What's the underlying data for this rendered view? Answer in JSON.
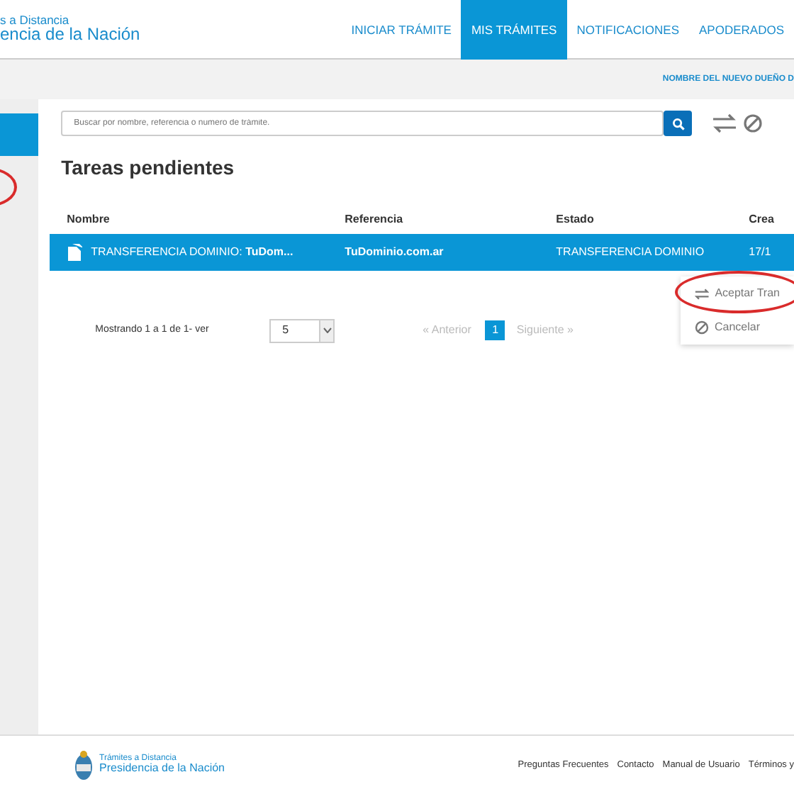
{
  "header": {
    "logo_line1": "s a Distancia",
    "logo_line2": "encia de la Nación",
    "nav": [
      {
        "label": "INICIAR TRÁMITE",
        "selected": false
      },
      {
        "label": "MIS TRÁMITES",
        "selected": true
      },
      {
        "label": "NOTIFICACIONES",
        "selected": false
      },
      {
        "label": "APODERADOS",
        "selected": false
      }
    ]
  },
  "subbar": {
    "user": "NOMBRE DEL NUEVO DUEÑO D"
  },
  "sidebar": {
    "items": [
      {
        "selected": true
      }
    ],
    "circled": true
  },
  "search": {
    "placeholder": "Buscar por nombre, referencia o numero de trámite."
  },
  "title": "Tareas pendientes",
  "table": {
    "columns": [
      "Nombre",
      "Referencia",
      "Estado",
      "Crea"
    ],
    "rows": [
      {
        "selected": true,
        "cells": [
          "TRANSFERENCIA DOMINIO: **TuDom...**",
          "TuDominio.com.ar",
          "TRANSFERENCIA DOMINIO",
          "17/1"
        ]
      }
    ]
  },
  "pagination": {
    "info": "Mostrando 1 a 1 de 1- ver",
    "page_size": "5",
    "prev": "« Anterior",
    "pages": [
      {
        "label": "1",
        "selected": true
      }
    ],
    "next": "Siguiente »"
  },
  "menu": [
    {
      "kind": "transfer",
      "label": "Aceptar Tran",
      "circled": true
    },
    {
      "kind": "cancel",
      "label": "Cancelar",
      "circled": false
    }
  ],
  "footer": {
    "logo_line1": "Trámites a Distancia",
    "logo_line2": "Presidencia de la Nación",
    "links": [
      "Preguntas Frecuentes",
      "Contacto",
      "Manual de Usuario",
      "Términos y"
    ]
  }
}
